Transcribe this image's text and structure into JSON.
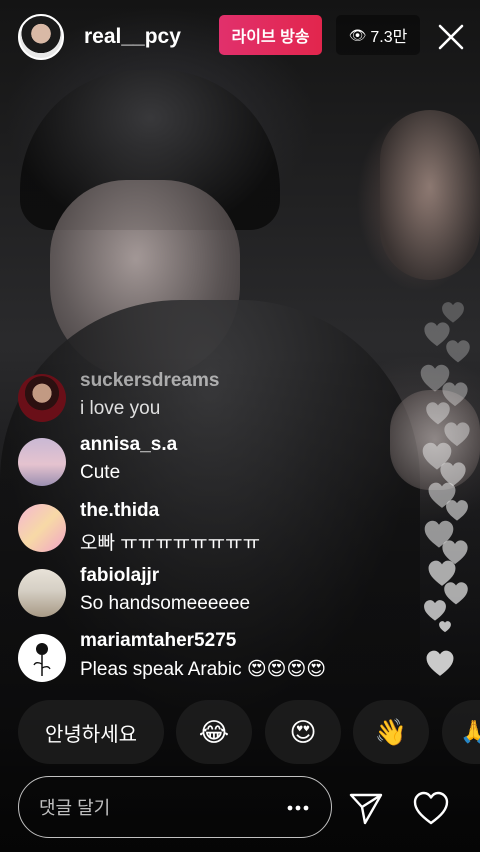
{
  "header": {
    "username": "real__pcy",
    "live_label": "라이브 방송",
    "viewer_count": "7.3만",
    "eye_icon": "eye-icon",
    "close_icon": "close-icon"
  },
  "comments": [
    {
      "user": "suckersdreams",
      "text": "i love you"
    },
    {
      "user": "annisa_s.a",
      "text": "Cute"
    },
    {
      "user": "the.thida",
      "text": "오빠 ㅠㅠㅠㅠㅠㅠㅠㅠ"
    },
    {
      "user": "fabiolajjr",
      "text": "So handsomeeeeee"
    },
    {
      "user": "mariamtaher5275",
      "text": "Pleas speak Arabic 😍😍😍😍"
    }
  ],
  "quick_replies": {
    "greeting": "안녕하세요",
    "laugh": "😂",
    "heart_eyes": "😍",
    "wave": "👋",
    "more": "🙏"
  },
  "composer": {
    "placeholder": "댓글 달기",
    "more_icon": "more-icon",
    "send_icon": "send-icon",
    "like_icon": "heart-icon"
  },
  "colors": {
    "live_badge": "#e1306c",
    "text": "#ffffff"
  }
}
